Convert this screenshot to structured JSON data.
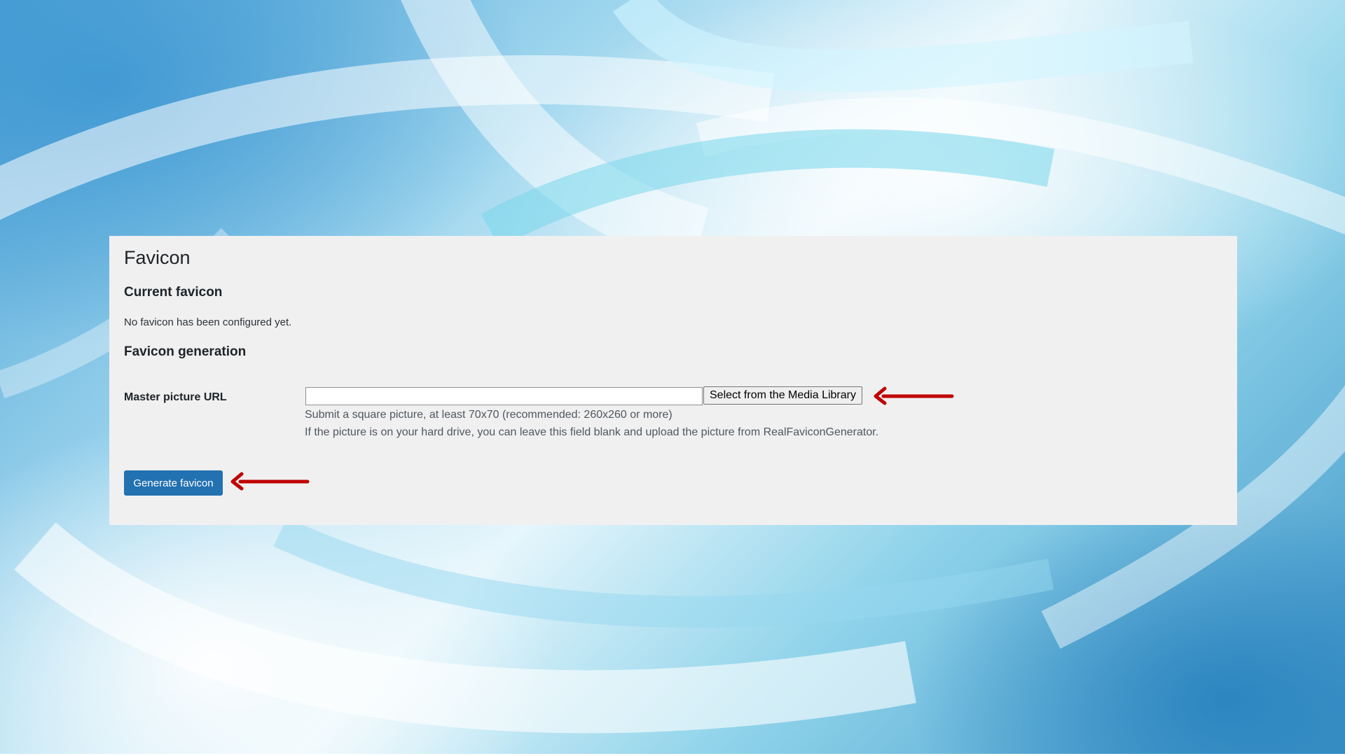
{
  "page": {
    "title": "Favicon"
  },
  "current_favicon": {
    "heading": "Current favicon",
    "status": "No favicon has been configured yet."
  },
  "favicon_generation": {
    "heading": "Favicon generation",
    "master_picture": {
      "label": "Master picture URL",
      "value": "",
      "placeholder": "",
      "select_button_label": "Select from the Media Library",
      "help_line_1": "Submit a square picture, at least 70x70 (recommended: 260x260 or more)",
      "help_line_2": "If the picture is on your hard drive, you can leave this field blank and upload the picture from RealFaviconGenerator."
    },
    "generate_button_label": "Generate favicon"
  },
  "colors": {
    "panel_background": "#f0f0f1",
    "primary_button": "#2271b1",
    "annotation_arrow": "#c00000"
  },
  "annotations": {
    "arrow_icon": "left-arrow-icon"
  }
}
